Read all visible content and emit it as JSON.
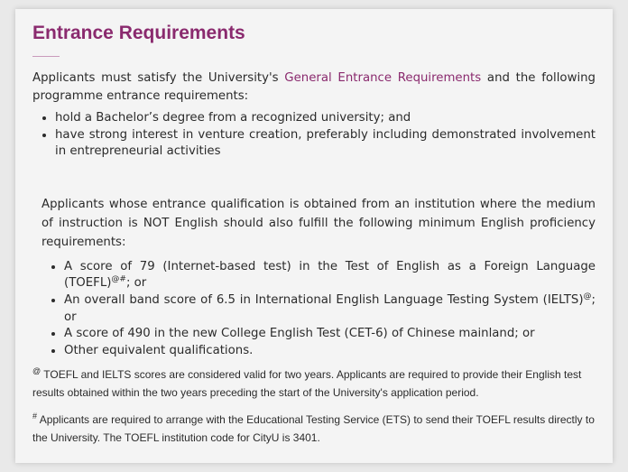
{
  "section": {
    "title": "Entrance Requirements",
    "intro_before": "Applicants must satisfy the University's ",
    "intro_link": "General Entrance Requirements",
    "intro_after": " and the following programme entrance requirements:",
    "requirements": [
      "hold a Bachelor’s degree from a recognized university; and",
      "have strong interest in venture creation, preferably including demonstrated involvement in entrepreneurial activities"
    ]
  },
  "english": {
    "intro": "Applicants whose entrance qualification is obtained from an institution where the medium of instruction is NOT English should also fulfill the following minimum English proficiency requirements:",
    "item1_text": "A score of 79 (Internet-based test) in the Test of English as a Foreign Language (TOEFL)",
    "item1_sup": "@#",
    "item1_tail": "; or",
    "item2_text": "An overall band score of 6.5 in International English Language Testing System (IELTS)",
    "item2_sup": "@",
    "item2_tail": "; or",
    "item3": "A score of 490 in the new College English Test (CET-6) of Chinese mainland; or",
    "item4": "Other equivalent qualifications."
  },
  "notes": {
    "note1_mark": "@",
    "note1": " TOEFL and IELTS scores are considered valid for two years. Applicants are required to provide their English test results obtained within the two years preceding the start of the University's application period.",
    "note2_mark": "#",
    "note2": " Applicants are required to arrange with the Educational Testing Service (ETS) to send their TOEFL results directly to the University. The TOEFL institution code for CityU is 3401."
  },
  "colors": {
    "accent": "#8a2a6e",
    "text": "#2b2b2b",
    "card_background": "#f4f4f4"
  }
}
